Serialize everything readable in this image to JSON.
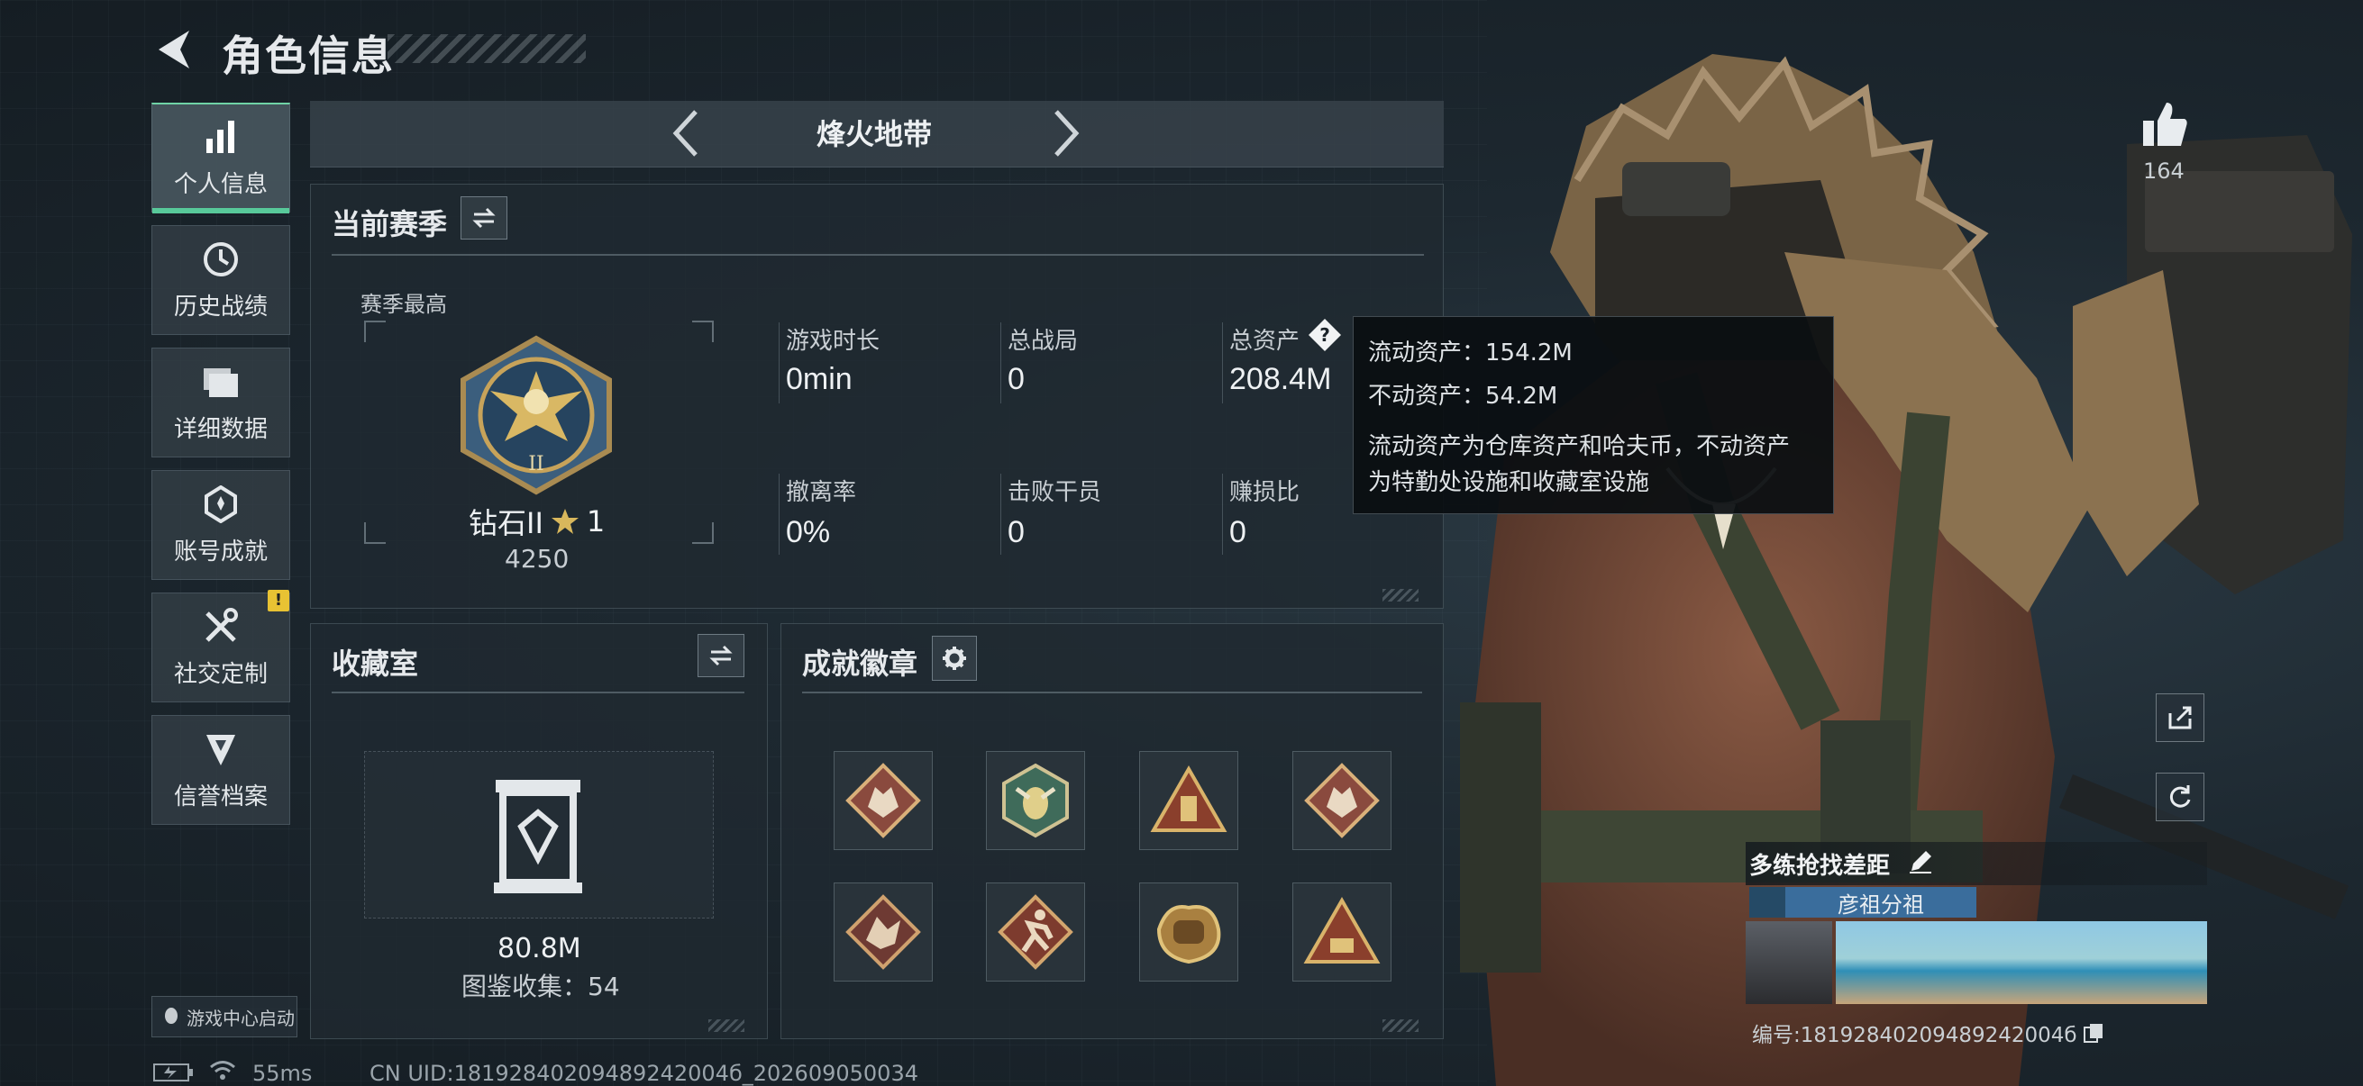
{
  "header": {
    "title": "角色信息"
  },
  "sidebar": {
    "items": [
      {
        "label": "个人信息",
        "icon": "bar-chart-icon",
        "active": true
      },
      {
        "label": "历史战绩",
        "icon": "clock-icon"
      },
      {
        "label": "详细数据",
        "icon": "folder-icon"
      },
      {
        "label": "账号成就",
        "icon": "achievement-icon"
      },
      {
        "label": "社交定制",
        "icon": "tools-icon"
      },
      {
        "label": "信誉档案",
        "icon": "credit-shield-icon"
      }
    ],
    "warning_badge": "!",
    "game_center": "游戏中心启动"
  },
  "season": {
    "name": "烽火地带"
  },
  "current_season": {
    "title": "当前赛季",
    "best_label": "赛季最高",
    "rank_name": "钻石II",
    "rank_stars": "1",
    "rank_score": "4250",
    "stats": [
      {
        "label": "游戏时长",
        "value": "0min"
      },
      {
        "label": "总战局",
        "value": "0"
      },
      {
        "label": "总资产",
        "value": "208.4M"
      },
      {
        "label": "撤离率",
        "value": "0%"
      },
      {
        "label": "击败干员",
        "value": "0"
      },
      {
        "label": "赚损比",
        "value": "0"
      }
    ]
  },
  "tooltip": {
    "liquid": "流动资产：154.2M",
    "fixed": "不动资产：54.2M",
    "desc_line1": "流动资产为仓库资产和哈夫币，不动资产",
    "desc_line2": "为特勤处设施和收藏室设施"
  },
  "collection": {
    "title": "收藏室",
    "value": "80.8M",
    "catalog": "图鉴收集：54"
  },
  "achievements": {
    "title": "成就徽章",
    "badges": [
      "wolf-badge",
      "bee-badge",
      "triangle-usb-badge",
      "wolf-badge",
      "dragon-badge",
      "runner-badge",
      "fist-badge",
      "triangle-56-badge"
    ]
  },
  "likes": {
    "count": "164"
  },
  "player": {
    "name": "多练抢找差距",
    "tag": "彦祖分祖",
    "uid_label": "编号:18192840209489242004б"
  },
  "footer": {
    "ping": "55ms",
    "uid": "CN UID:18192840209489242004б_202609050034"
  },
  "colors": {
    "accent": "#58c99a",
    "gold": "#c9a24a",
    "panel": "#202a31"
  }
}
